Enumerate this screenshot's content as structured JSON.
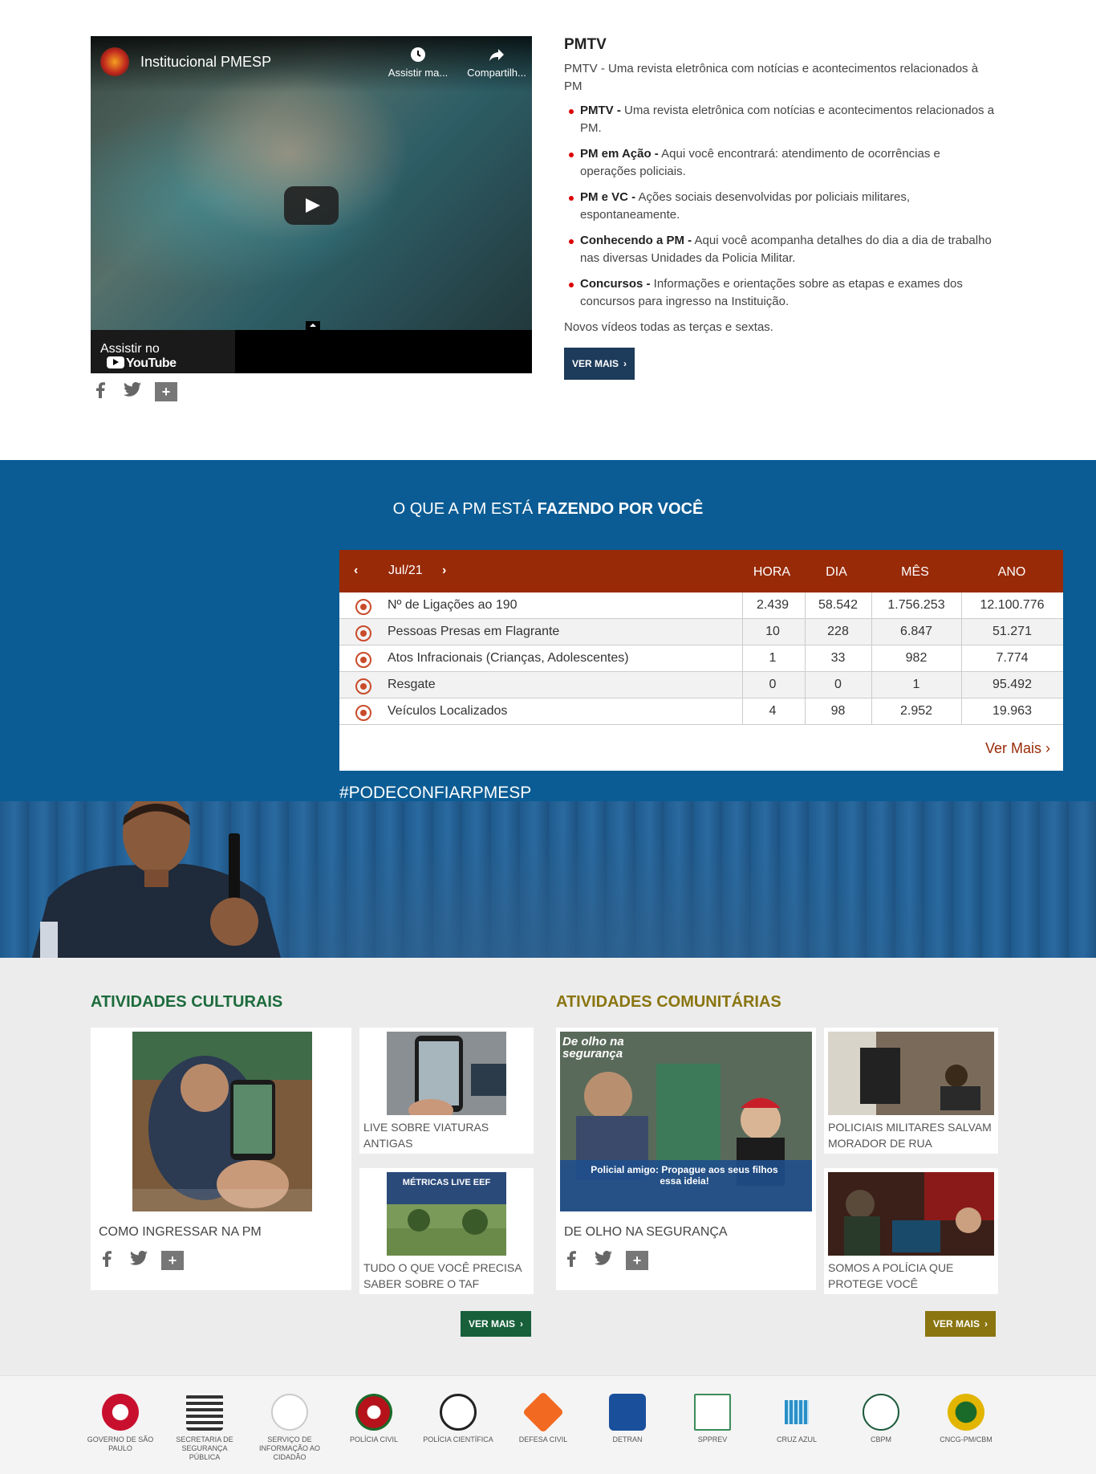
{
  "pmtv": {
    "video": {
      "channel_title": "Institucional PMESP",
      "watch_later": "Assistir ma...",
      "share": "Compartilh...",
      "watch_on": "Assistir no",
      "youtube": "YouTube"
    },
    "title": "PMTV",
    "intro": "PMTV - Uma revista eletrônica com notícias e acontecimentos relacionados à PM",
    "items": [
      {
        "bold": "PMTV -",
        "text": " Uma revista eletrônica com notícias e acontecimentos relacionados a PM."
      },
      {
        "bold": "PM em Ação -",
        "text": " Aqui você encontrará: atendimento de ocorrências e operações policiais."
      },
      {
        "bold": "PM e VC -",
        "text": " Ações sociais desenvolvidas por policiais militares, espontaneamente."
      },
      {
        "bold": "Conhecendo a PM -",
        "text": " Aqui você acompanha detalhes do dia a dia de trabalho nas diversas Unidades da Policia Militar."
      },
      {
        "bold": "Concursos -",
        "text": " Informações e orientações sobre as etapas e exames dos concursos para ingresso na Instituição."
      }
    ],
    "note": "Novos vídeos todas as terças e sextas.",
    "ver_mais": "VER MAIS"
  },
  "share": {
    "facebook": "f",
    "twitter": "t",
    "plus": "+"
  },
  "stats": {
    "title_light": "O QUE A PM ESTÁ ",
    "title_bold": "FAZENDO POR VOCÊ",
    "month": "Jul/21",
    "prev": "‹",
    "next": "›",
    "columns": [
      "HORA",
      "DIA",
      "MÊS",
      "ANO"
    ],
    "rows": [
      {
        "label": "Nº de Ligações ao 190",
        "icon": "phone-icon",
        "values": [
          "2.439",
          "58.542",
          "1.756.253",
          "12.100.776"
        ]
      },
      {
        "label": "Pessoas Presas em Flagrante",
        "icon": "arrest-icon",
        "values": [
          "10",
          "228",
          "6.847",
          "51.271"
        ]
      },
      {
        "label": "Atos Infracionais (Crianças, Adolescentes)",
        "icon": "child-icon",
        "values": [
          "1",
          "33",
          "982",
          "7.774"
        ]
      },
      {
        "label": "Resgate",
        "icon": "rescue-icon",
        "values": [
          "0",
          "0",
          "1",
          "95.492"
        ]
      },
      {
        "label": "Veículos Localizados",
        "icon": "vehicle-icon",
        "values": [
          "4",
          "98",
          "2.952",
          "19.963"
        ]
      }
    ],
    "ver_mais": "Ver Mais ›",
    "accent": "#982a07"
  },
  "hashtag": "#PODECONFIARPMESP",
  "culturais": {
    "title_light": "ATIVIDADES ",
    "title_bold": "CULTURAIS",
    "main_caption": "COMO INGRESSAR NA PM",
    "side": [
      {
        "caption": "LIVE SOBRE VIATURAS ANTIGAS"
      },
      {
        "caption": "TUDO O QUE VOCÊ PRECISA SABER SOBRE O TAF",
        "image_text": "MÉTRICAS LIVE EEF"
      }
    ],
    "ver_mais": "VER MAIS",
    "color": "#1c6b3c"
  },
  "comunitarias": {
    "title_light": "ATIVIDADES ",
    "title_bold": "COMUNITÁRIAS",
    "main_caption": "DE OLHO NA SEGURANÇA",
    "main_image_text": "Policial amigo: Propague aos seus filhos essa ideia!",
    "main_image_logo": "De olho na segurança",
    "side": [
      {
        "caption": "POLICIAIS MILITARES SALVAM MORADOR DE RUA"
      },
      {
        "caption": "SOMOS A POLÍCIA QUE PROTEGE VOCÊ"
      }
    ],
    "ver_mais": "VER MAIS",
    "color": "#8a7510"
  },
  "footer_logos": [
    {
      "label": "GOVERNO DE SÃO PAULO",
      "color": "#c8102e"
    },
    {
      "label": "SECRETARIA DE SEGURANÇA PÚBLICA",
      "color": "#333333"
    },
    {
      "label": "SERVIÇO DE INFORMAÇÃO AO CIDADÃO",
      "color": "#444444"
    },
    {
      "label": "POLÍCIA CIVIL",
      "color": "#b5121b"
    },
    {
      "label": "POLÍCIA CIENTÍFICA",
      "color": "#222222"
    },
    {
      "label": "DEFESA CIVIL",
      "color": "#f26a21"
    },
    {
      "label": "DETRAN",
      "color": "#1a4f9c"
    },
    {
      "label": "SPPREV",
      "color": "#3c8c5a"
    },
    {
      "label": "CRUZ AZUL",
      "color": "#2a8fc7"
    },
    {
      "label": "CBPM",
      "color": "#1c5a3c"
    },
    {
      "label": "CNCG-PM/CBM",
      "color": "#e2b500"
    }
  ]
}
